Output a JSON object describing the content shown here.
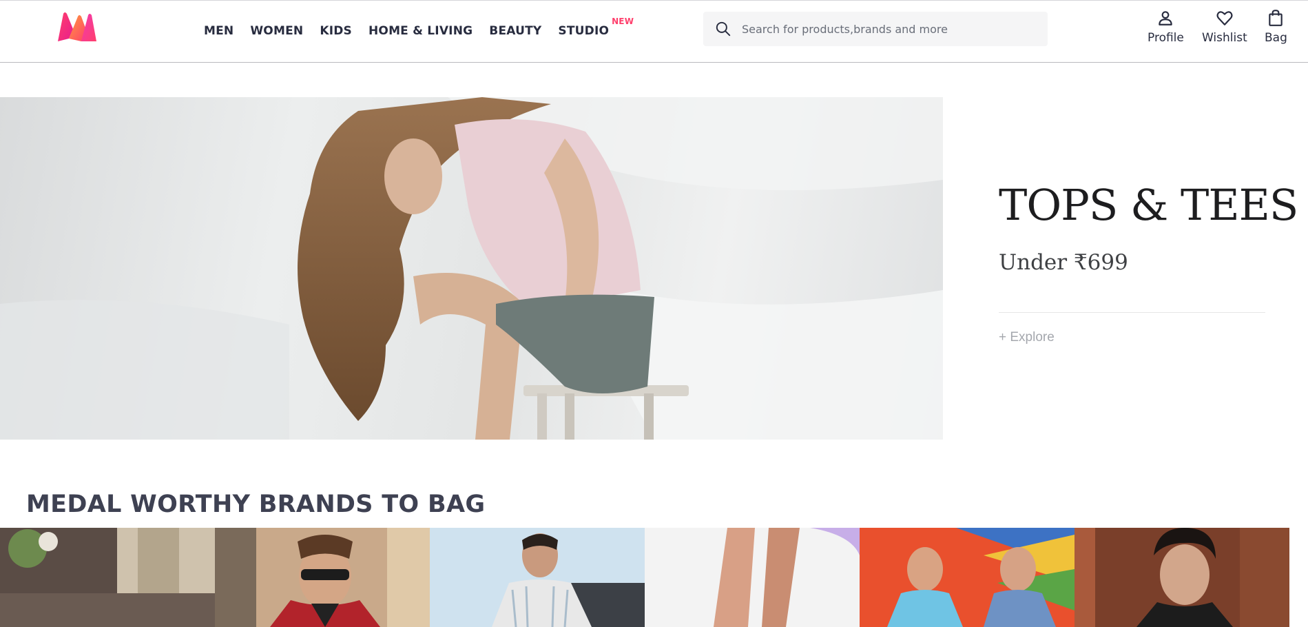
{
  "header": {
    "nav": [
      {
        "label": "MEN"
      },
      {
        "label": "WOMEN"
      },
      {
        "label": "KIDS"
      },
      {
        "label": "HOME & LIVING"
      },
      {
        "label": "BEAUTY"
      },
      {
        "label": "STUDIO",
        "badge": "NEW"
      }
    ],
    "search": {
      "placeholder": "Search for products,brands and more",
      "icon": "search-icon"
    },
    "actions": [
      {
        "label": "Profile",
        "icon": "profile-icon"
      },
      {
        "label": "Wishlist",
        "icon": "heart-icon"
      },
      {
        "label": "Bag",
        "icon": "bag-icon"
      }
    ]
  },
  "hero": {
    "title": "TOPS & TEES",
    "subtitle": "Under ₹699",
    "cta": "+ Explore"
  },
  "brands_section": {
    "title": "MEDAL WORTHY BRANDS TO BAG"
  },
  "colors": {
    "brand_pink": "#ff3f6c",
    "text_dark": "#282c3f",
    "search_bg": "#f5f5f6"
  }
}
